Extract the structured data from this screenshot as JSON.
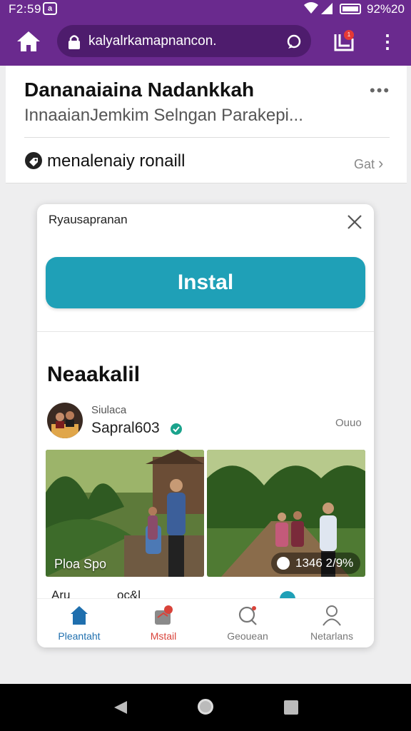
{
  "status_bar": {
    "time": "F2:59",
    "battery_text": "92%20",
    "notification_glyph": "a"
  },
  "browser": {
    "url": "kalyalrkamapnancon.",
    "tabs_badge": "1"
  },
  "page": {
    "title": "Dananaiaina Nadankkah",
    "subtitle": "InnaaianJemkim Selngan Parakepi...",
    "link_label": "menalenaiy ronaill",
    "link_action": "Gat"
  },
  "modal": {
    "title": "Ryausapranan",
    "install_label": "Instal",
    "section_title": "Neaakalil",
    "account": {
      "label": "Siulaca",
      "name": "Sapral603",
      "meta": "Ouuo"
    },
    "photos": [
      {
        "caption": "Ploa Spo"
      },
      {
        "counter": "1346 2/9%"
      }
    ],
    "cutoff_text": [
      "Aru",
      "oc&l"
    ],
    "bottom_nav": [
      {
        "label": "Pleantaht",
        "icon": "home-icon",
        "active": true
      },
      {
        "label": "Mstail",
        "icon": "mail-icon"
      },
      {
        "label": "Geouean",
        "icon": "search-icon"
      },
      {
        "label": "Netarlans",
        "icon": "profile-icon"
      }
    ]
  },
  "colors": {
    "browser_bar": "#6a2a8e",
    "url_field": "#4e1c6d",
    "install_button": "#1fa0b7",
    "nav_active": "#1f6fae",
    "nav_mail": "#d9433a"
  }
}
